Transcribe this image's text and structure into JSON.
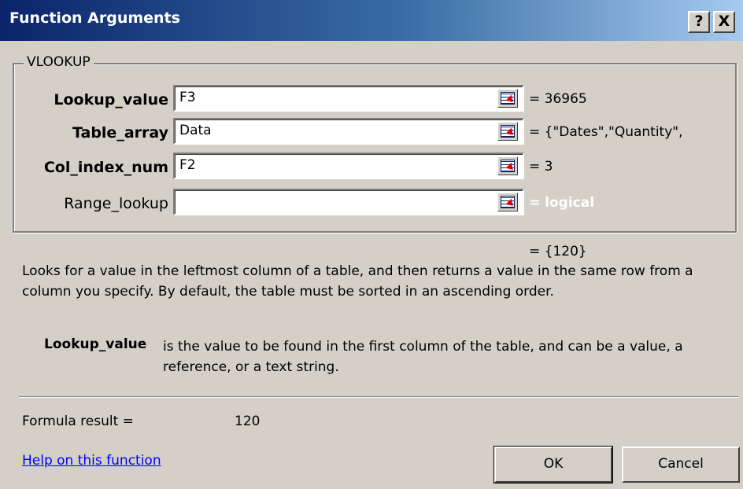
{
  "window": {
    "title": "Function Arguments",
    "help_button": "?",
    "close_button": "X"
  },
  "function_group": {
    "name": "VLOOKUP",
    "arguments": [
      {
        "label": "Lookup_value",
        "bold": true,
        "value": "F3",
        "result": "= 36965"
      },
      {
        "label": "Table_array",
        "bold": true,
        "value": "Data",
        "result": "= {\"Dates\",\"Quantity\","
      },
      {
        "label": "Col_index_num",
        "bold": true,
        "value": "F2",
        "result": "= 3"
      },
      {
        "label": "Range_lookup",
        "bold": false,
        "value": "",
        "result": "= logical"
      }
    ]
  },
  "formula_value": "= {120}",
  "description": "Looks for a value in the leftmost column of a table, and then returns a value in the same row from a column you specify. By default, the table must be sorted in an ascending order.",
  "argument_help": {
    "name": "Lookup_value",
    "text": "is the value to be found in the first column of the table, and can be a value, a reference, or a text string."
  },
  "formula_result": {
    "label": "Formula result =",
    "value": "120"
  },
  "help_link": "Help on this function",
  "buttons": {
    "ok": "OK",
    "cancel": "Cancel"
  }
}
